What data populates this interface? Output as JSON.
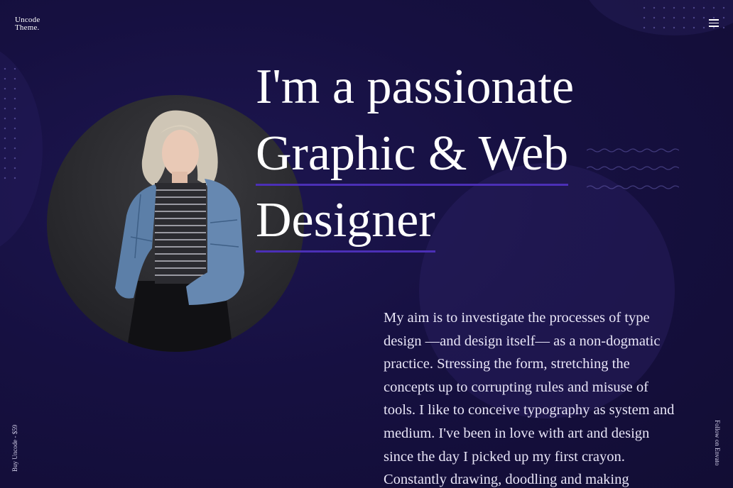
{
  "logo": {
    "line1": "Uncode",
    "line2": "Theme."
  },
  "menu": {
    "icon": "hamburger-menu-icon"
  },
  "hero": {
    "line1": "I'm a passionate",
    "line2": "Graphic & Web",
    "line3": "Designer",
    "accent_color": "#4b2fb6"
  },
  "bio": {
    "text": "My aim is to investigate the processes of type design —and design itself— as a non-dogmatic practice. Stressing the form, stretching the concepts up to corrupting rules and misuse of tools. I like to conceive typography as system and medium. I've been in love with art and design since the day I picked up my first crayon. Constantly drawing, doodling and making"
  },
  "side": {
    "left_label": "Buy Uncode - $59",
    "right_label": "Follow on Envato"
  },
  "colors": {
    "background": "#151038",
    "text": "#ffffff"
  }
}
